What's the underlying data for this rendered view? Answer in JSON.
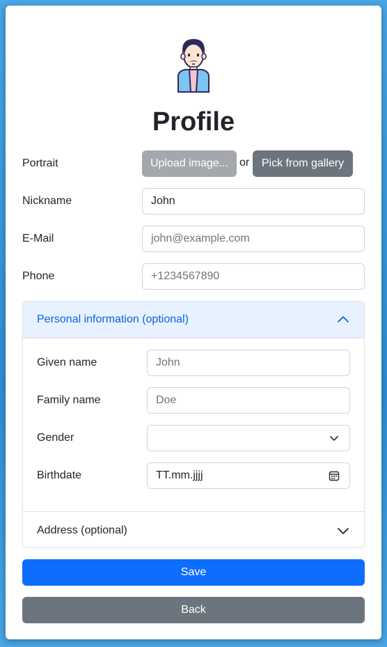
{
  "page": {
    "title": "Profile",
    "avatar_icon": "person-avatar-icon"
  },
  "portrait": {
    "label": "Portrait",
    "upload_label": "Upload image...",
    "or_text": "or",
    "gallery_label": "Pick from gallery"
  },
  "nickname": {
    "label": "Nickname",
    "value": "John",
    "placeholder": ""
  },
  "email": {
    "label": "E-Mail",
    "value": "",
    "placeholder": "john@example.com"
  },
  "phone": {
    "label": "Phone",
    "value": "",
    "placeholder": "+1234567890"
  },
  "personal_info": {
    "title": "Personal information (optional)",
    "expanded": true,
    "given_name": {
      "label": "Given name",
      "value": "",
      "placeholder": "John"
    },
    "family_name": {
      "label": "Family name",
      "value": "",
      "placeholder": "Doe"
    },
    "gender": {
      "label": "Gender",
      "selected": ""
    },
    "birthdate": {
      "label": "Birthdate",
      "value": "TT.mm.jjjj"
    }
  },
  "address": {
    "title": "Address (optional)",
    "expanded": false
  },
  "actions": {
    "save_label": "Save",
    "back_label": "Back"
  },
  "colors": {
    "primary": "#0d6efd",
    "secondary": "#6c757d",
    "secondary_disabled": "#a4a8ad",
    "accordion_active_bg": "#e7f1ff",
    "accordion_active_text": "#0c63e4",
    "background": "#3d9be0"
  }
}
